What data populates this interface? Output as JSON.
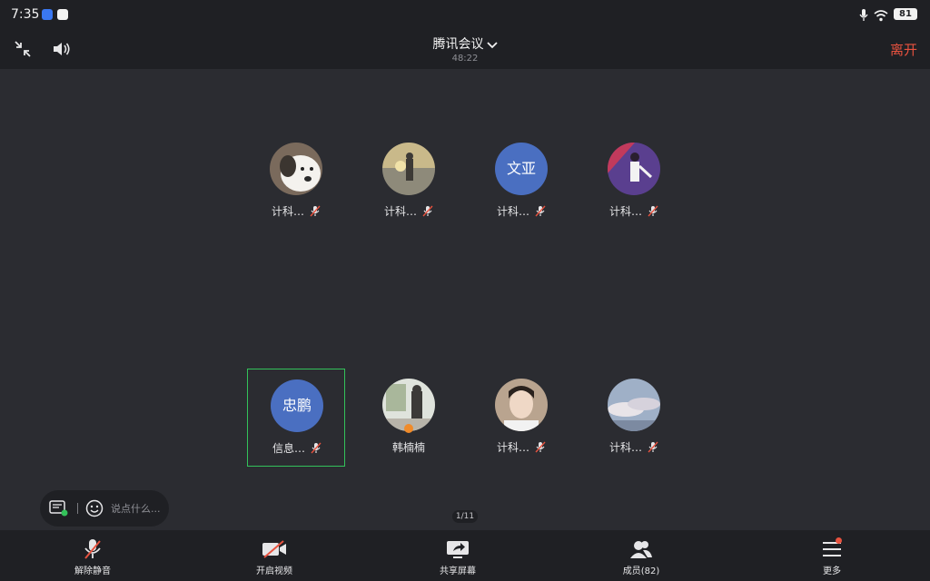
{
  "status_bar": {
    "time": "7:35",
    "battery": "81"
  },
  "header": {
    "title": "腾讯会议",
    "timer": "48:22",
    "leave_label": "离开"
  },
  "participants": [
    {
      "name": "计科…",
      "avatar_type": "photo",
      "avatar_desc": "dog",
      "muted": true
    },
    {
      "name": "计科…",
      "avatar_type": "photo",
      "avatar_desc": "sunset-person",
      "muted": true
    },
    {
      "name": "计科…",
      "avatar_type": "text",
      "avatar_text": "文亚",
      "muted": true
    },
    {
      "name": "计科…",
      "avatar_type": "photo",
      "avatar_desc": "dancer",
      "muted": true
    },
    {
      "name": "信息…",
      "avatar_type": "text",
      "avatar_text": "忠鹏",
      "muted": true,
      "active_speaker": true
    },
    {
      "name": "韩楠楠",
      "avatar_type": "photo",
      "avatar_desc": "window-person",
      "muted": false,
      "sharing": true
    },
    {
      "name": "计科…",
      "avatar_type": "photo",
      "avatar_desc": "young-man",
      "muted": true
    },
    {
      "name": "计科…",
      "avatar_type": "photo",
      "avatar_desc": "clouds",
      "muted": true
    }
  ],
  "pager": "1/11",
  "chat": {
    "placeholder": "说点什么..."
  },
  "toolbar": {
    "unmute_label": "解除静音",
    "video_label": "开启视频",
    "share_label": "共享屏幕",
    "members_label": "成员(82)",
    "more_label": "更多"
  },
  "icons": {
    "status": [
      "app-icon",
      "qq-icon",
      "mic-icon",
      "wifi-icon",
      "battery-icon"
    ],
    "header": [
      "shrink-icon",
      "speaker-icon",
      "chevron-down-icon"
    ],
    "toolbar": [
      "mic-muted-icon",
      "video-off-icon",
      "share-screen-icon",
      "members-icon",
      "menu-icon"
    ]
  },
  "colors": {
    "leave": "#e8523f",
    "active_border": "#33c25a",
    "text_avatar": "#4a6fc1",
    "mute_slash": "#e8523f"
  }
}
